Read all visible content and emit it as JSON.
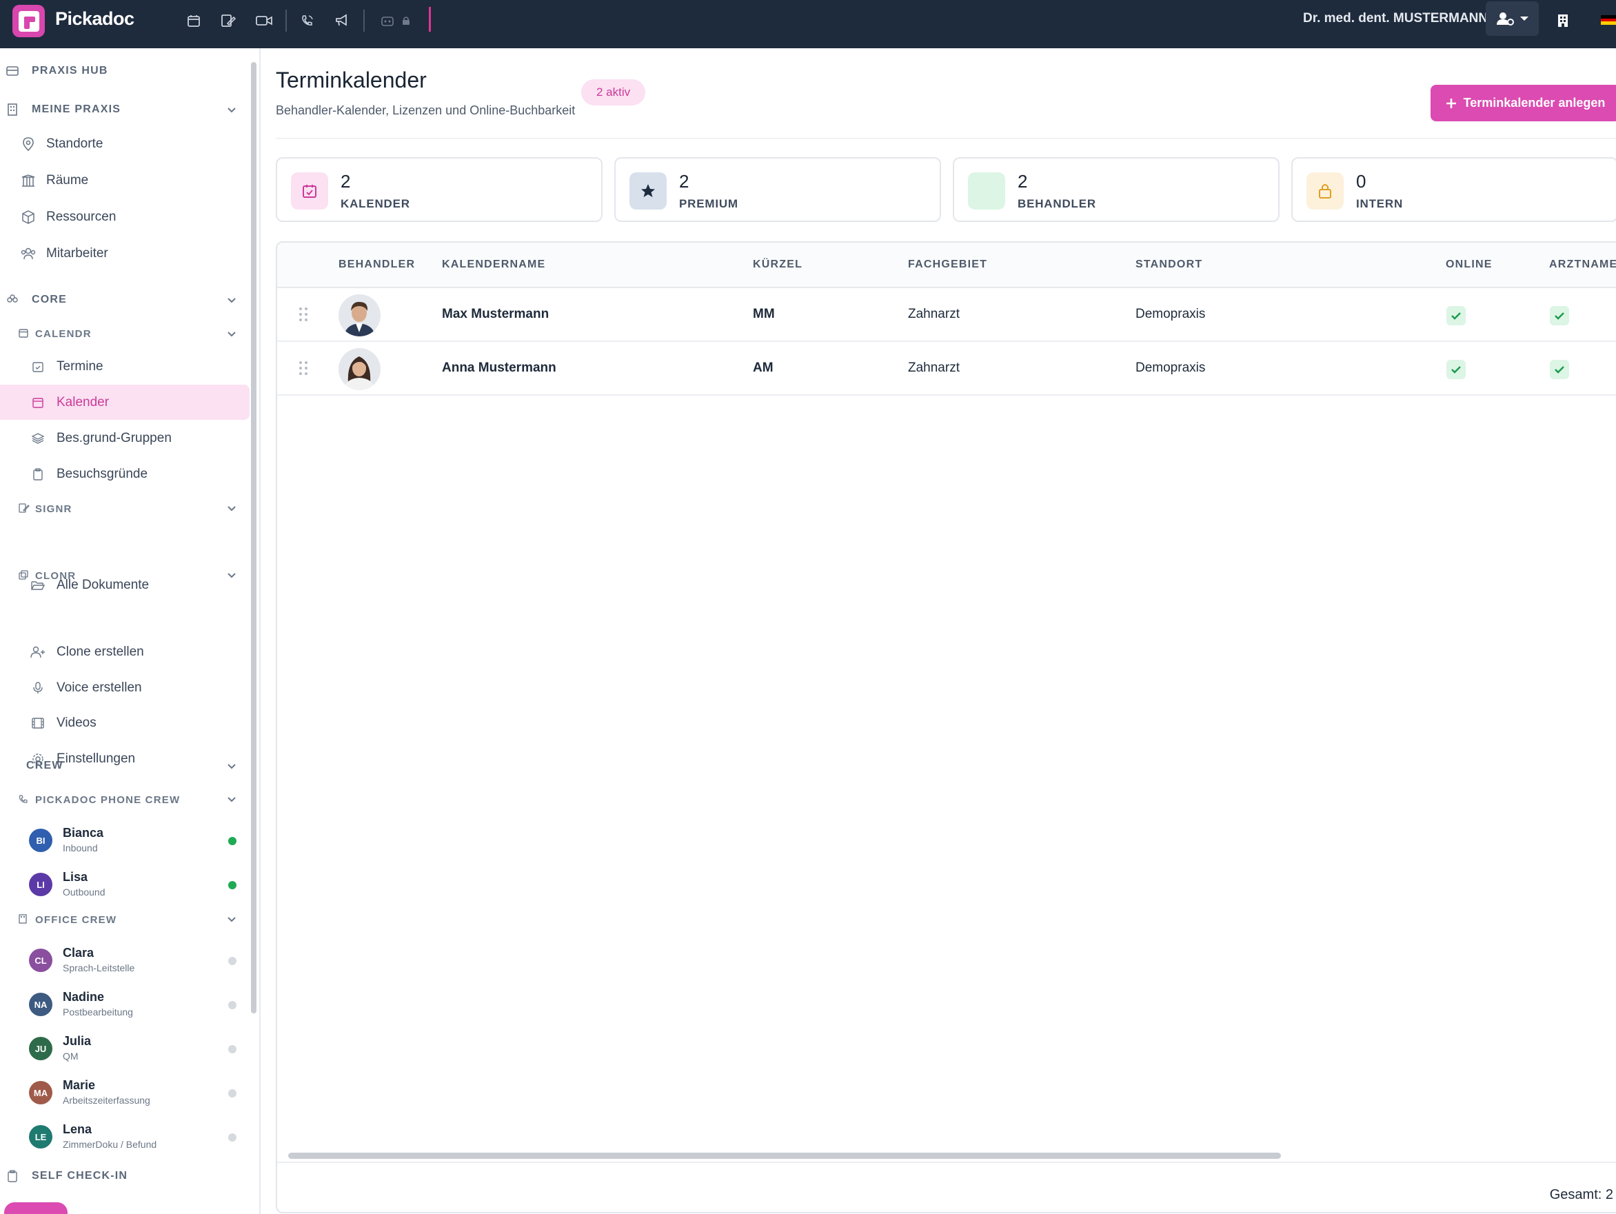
{
  "app": {
    "brand": "Pickadoc",
    "user_name": "Dr. med. dent. MUSTERMANN"
  },
  "sidebar": {
    "praxis_hub": "PRAXIS HUB",
    "meine_praxis": "MEINE PRAXIS",
    "meine_praxis_items": [
      {
        "label": "Standorte"
      },
      {
        "label": "Räume"
      },
      {
        "label": "Ressourcen"
      },
      {
        "label": "Mitarbeiter"
      }
    ],
    "core": "CORE",
    "calendr": "CALENDR",
    "calendr_items": [
      {
        "label": "Termine"
      },
      {
        "label": "Kalender"
      },
      {
        "label": "Bes.grund-Gruppen"
      },
      {
        "label": "Besuchsgründe"
      }
    ],
    "signr": "SIGNR",
    "signr_items": [
      {
        "label": "Alle Dokumente"
      }
    ],
    "clonr": "CLONR",
    "clonr_items": [
      {
        "label": "Clone erstellen"
      },
      {
        "label": "Voice erstellen"
      },
      {
        "label": "Videos"
      },
      {
        "label": "Einstellungen"
      }
    ],
    "crew": "CREW",
    "phone_crew": "PICKADOC PHONE CREW",
    "phone_crew_members": [
      {
        "initials": "BI",
        "name": "Bianca",
        "role": "Inbound",
        "color": "#2f5fae",
        "status": "#1faa55"
      },
      {
        "initials": "LI",
        "name": "Lisa",
        "role": "Outbound",
        "color": "#5b3aa8",
        "status": "#1faa55"
      }
    ],
    "office_crew": "OFFICE CREW",
    "office_crew_members": [
      {
        "initials": "CL",
        "name": "Clara",
        "role": "Sprach-Leitstelle",
        "color": "#8a4f9e",
        "status": "#d6d9de"
      },
      {
        "initials": "NA",
        "name": "Nadine",
        "role": "Postbearbeitung",
        "color": "#3d5a80",
        "status": "#d6d9de"
      },
      {
        "initials": "JU",
        "name": "Julia",
        "role": "QM",
        "color": "#2e6b4a",
        "status": "#d6d9de"
      },
      {
        "initials": "MA",
        "name": "Marie",
        "role": "Arbeitszeiterfassung",
        "color": "#a05a4a",
        "status": "#d6d9de"
      },
      {
        "initials": "LE",
        "name": "Lena",
        "role": "ZimmerDoku / Befund",
        "color": "#1f7a70",
        "status": "#d6d9de"
      }
    ],
    "self_checkin": "SELF CHECK-IN"
  },
  "page": {
    "title": "Terminkalender",
    "subtitle": "Behandler-Kalender, Lizenzen und Online-Buchbarkeit",
    "badge": "2 aktiv",
    "create_button": "Terminkalender anlegen"
  },
  "stats": [
    {
      "value": "2",
      "label": "KALENDER",
      "icon": "calendar-check-icon"
    },
    {
      "value": "2",
      "label": "PREMIUM",
      "icon": "star-icon"
    },
    {
      "value": "2",
      "label": "BEHANDLER",
      "icon": "user-icon"
    },
    {
      "value": "0",
      "label": "INTERN",
      "icon": "lock-icon"
    }
  ],
  "table": {
    "columns": [
      "BEHANDLER",
      "KALENDERNAME",
      "KÜRZEL",
      "FACHGEBIET",
      "STANDORT",
      "ONLINE",
      "ARZTNAME"
    ],
    "rows": [
      {
        "name": "Max Mustermann",
        "short": "MM",
        "field": "Zahnarzt",
        "location": "Demopraxis",
        "online": true,
        "arztname": true
      },
      {
        "name": "Anna Mustermann",
        "short": "AM",
        "field": "Zahnarzt",
        "location": "Demopraxis",
        "online": true,
        "arztname": true
      }
    ],
    "total": "Gesamt: 2"
  },
  "colors": {
    "accent": "#db4bb1",
    "topbar": "#1e2b3d"
  }
}
